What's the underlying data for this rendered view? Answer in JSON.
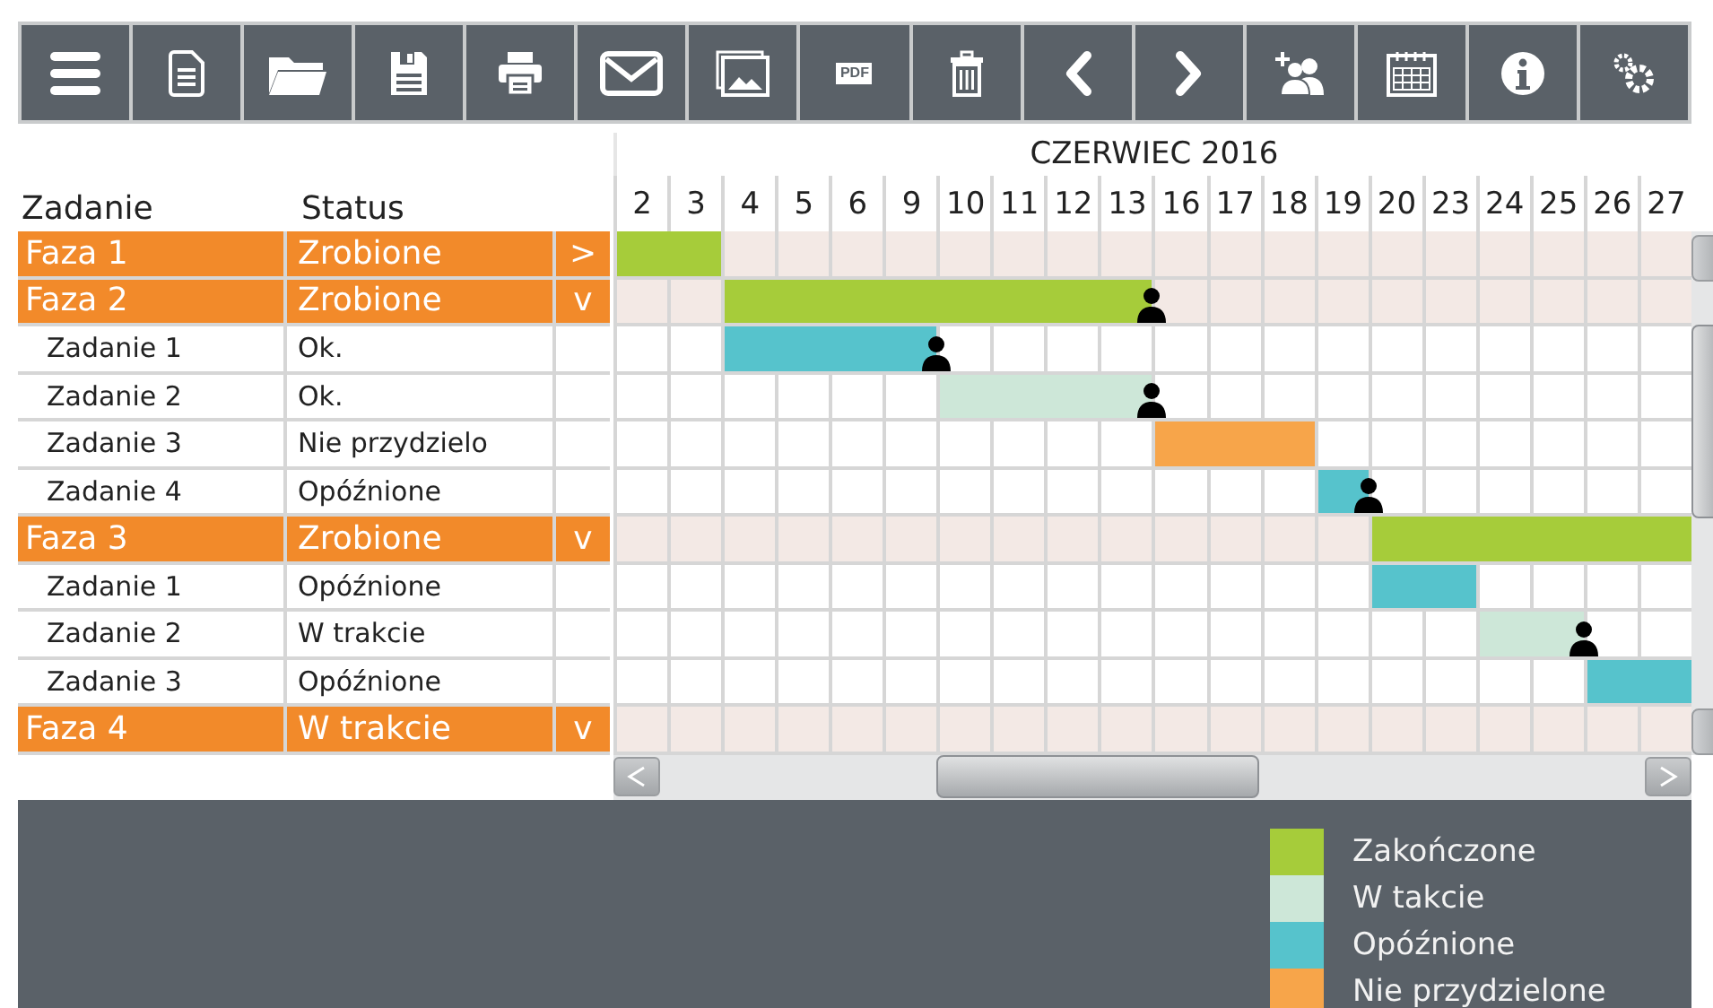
{
  "toolbar": [
    {
      "kind": "menu"
    },
    {
      "kind": "document"
    },
    {
      "kind": "folder"
    },
    {
      "kind": "save"
    },
    {
      "kind": "print"
    },
    {
      "kind": "mail"
    },
    {
      "kind": "image"
    },
    {
      "kind": "pdf",
      "label": "PDF"
    },
    {
      "kind": "trash"
    },
    {
      "kind": "prev"
    },
    {
      "kind": "next"
    },
    {
      "kind": "add-user"
    },
    {
      "kind": "calendar"
    },
    {
      "kind": "info"
    },
    {
      "kind": "settings"
    }
  ],
  "columns": [
    "Zadanie",
    "Status"
  ],
  "month": "CZERWIEC 2016",
  "days": [
    "2",
    "3",
    "4",
    "5",
    "6",
    "9",
    "10",
    "11",
    "12",
    "13",
    "16",
    "17",
    "18",
    "19",
    "20",
    "23",
    "24",
    "25",
    "26",
    "27"
  ],
  "phases": [
    {
      "name": "Faza 1",
      "status": "Zrobione",
      "toggle": ">",
      "bar": {
        "color": "#a6cc3a",
        "assigned": false,
        "filled": [
          true,
          true,
          false,
          false,
          false,
          false,
          false,
          false,
          false,
          false,
          false,
          false,
          false,
          false,
          false,
          false,
          false,
          false,
          false,
          false
        ]
      }
    },
    {
      "name": "Faza 2",
      "status": "Zrobione",
      "toggle": "v",
      "bar": {
        "color": "#a6cc3a",
        "assigned": true,
        "filled": [
          false,
          false,
          true,
          true,
          true,
          true,
          true,
          true,
          true,
          true,
          false,
          false,
          false,
          false,
          false,
          false,
          false,
          false,
          false,
          false
        ]
      },
      "children": [
        {
          "name": "Zadanie 1",
          "status": "Ok.",
          "bar": {
            "color": "#56c3cc",
            "assigned": true,
            "filled": [
              false,
              false,
              true,
              true,
              true,
              true,
              false,
              false,
              false,
              false,
              false,
              false,
              false,
              false,
              false,
              false,
              false,
              false,
              false,
              false
            ]
          }
        },
        {
          "name": "Zadanie 2",
          "status": "Ok.",
          "bar": {
            "color": "#cde7d8",
            "assigned": true,
            "filled": [
              false,
              false,
              false,
              false,
              false,
              false,
              true,
              true,
              true,
              true,
              false,
              false,
              false,
              false,
              false,
              false,
              false,
              false,
              false,
              false
            ]
          }
        },
        {
          "name": "Zadanie 3",
          "status": "Nie przydzielo",
          "bar": {
            "color": "#f7a54a",
            "assigned": false,
            "filled": [
              false,
              false,
              false,
              false,
              false,
              false,
              false,
              false,
              false,
              false,
              true,
              true,
              true,
              false,
              false,
              false,
              false,
              false,
              false,
              false
            ]
          }
        },
        {
          "name": "Zadanie 4",
          "status": "Opóźnione",
          "bar": {
            "color": "#56c3cc",
            "assigned": true,
            "filled": [
              false,
              false,
              false,
              false,
              false,
              false,
              false,
              false,
              false,
              false,
              false,
              false,
              false,
              true,
              false,
              false,
              false,
              false,
              false,
              false
            ]
          }
        }
      ]
    },
    {
      "name": "Faza 3",
      "status": "Zrobione",
      "toggle": "v",
      "bar": {
        "color": "#a6cc3a",
        "assigned": false,
        "filled": [
          false,
          false,
          false,
          false,
          false,
          false,
          false,
          false,
          false,
          false,
          false,
          false,
          false,
          false,
          true,
          true,
          true,
          true,
          true,
          true
        ]
      },
      "children": [
        {
          "name": "Zadanie 1",
          "status": "Opóźnione",
          "bar": {
            "color": "#56c3cc",
            "assigned": false,
            "filled": [
              false,
              false,
              false,
              false,
              false,
              false,
              false,
              false,
              false,
              false,
              false,
              false,
              false,
              false,
              true,
              true,
              false,
              false,
              false,
              false
            ]
          }
        },
        {
          "name": "Zadanie 2",
          "status": " W trakcie",
          "bar": {
            "color": "#cde7d8",
            "assigned": true,
            "filled": [
              false,
              false,
              false,
              false,
              false,
              false,
              false,
              false,
              false,
              false,
              false,
              false,
              false,
              false,
              false,
              false,
              true,
              true,
              false,
              false
            ]
          }
        },
        {
          "name": "Zadanie 3",
          "status": "Opóźnione",
          "bar": {
            "color": "#56c3cc",
            "assigned": false,
            "filled": [
              false,
              false,
              false,
              false,
              false,
              false,
              false,
              false,
              false,
              false,
              false,
              false,
              false,
              false,
              false,
              false,
              false,
              false,
              true,
              true
            ]
          }
        }
      ]
    },
    {
      "name": "Faza 4",
      "status": "W trakcie",
      "toggle": "v"
    }
  ],
  "legend": [
    {
      "label": "Zakończone",
      "color": "#a6cc3a"
    },
    {
      "label": "W takcie",
      "color": "#cde7d8"
    },
    {
      "label": "Opóźnione",
      "color": "#56c3cc"
    },
    {
      "label": "Nie przydzielone",
      "color": "#f7a54a"
    }
  ]
}
